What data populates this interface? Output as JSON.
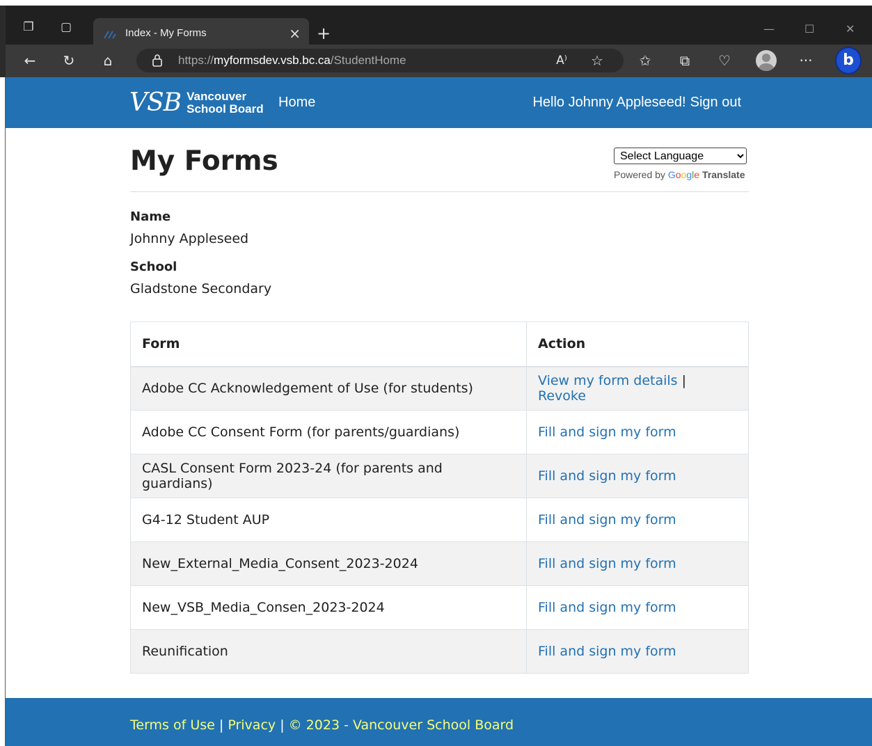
{
  "browser": {
    "tab_title": "Index - My Forms",
    "url_prefix": "https://",
    "url_host": "myformsdev.vsb.bc.ca",
    "url_path": "/StudentHome"
  },
  "header": {
    "logo_letters": "VSB",
    "logo_line1": "Vancouver",
    "logo_line2": "School Board",
    "nav_home": "Home",
    "greeting": "Hello Johnny Appleseed!",
    "sign_out": "Sign out"
  },
  "page": {
    "title": "My Forms",
    "language_select": "Select Language",
    "powered_by": "Powered by",
    "google": [
      "G",
      "o",
      "o",
      "g",
      "l",
      "e"
    ],
    "translate": "Translate"
  },
  "student": {
    "name_label": "Name",
    "name_value": "Johnny Appleseed",
    "school_label": "School",
    "school_value": "Gladstone Secondary"
  },
  "table": {
    "headers": [
      "Form",
      "Action"
    ],
    "rows": [
      {
        "form": "Adobe CC Acknowledgement of Use (for students)",
        "action": "View my form details",
        "action2": "Revoke"
      },
      {
        "form": "Adobe CC Consent Form (for parents/guardians)",
        "action": "Fill and sign my form"
      },
      {
        "form": "CASL Consent Form 2023-24 (for parents and guardians)",
        "action": "Fill and sign my form"
      },
      {
        "form": "G4-12 Student AUP",
        "action": "Fill and sign my form"
      },
      {
        "form": "New_External_Media_Consent_2023-2024",
        "action": "Fill and sign my form"
      },
      {
        "form": "New_VSB_Media_Consen_2023-2024",
        "action": "Fill and sign my form"
      },
      {
        "form": "Reunification",
        "action": "Fill and sign my form"
      }
    ],
    "separator": "|"
  },
  "footer": {
    "terms": "Terms of Use",
    "privacy": "Privacy",
    "copyright": "© 2023 - Vancouver School Board",
    "separator": "|"
  },
  "colors": {
    "brand_blue": "#2271b3",
    "footer_link": "#f5ff7a",
    "chrome_dark": "#202020"
  }
}
